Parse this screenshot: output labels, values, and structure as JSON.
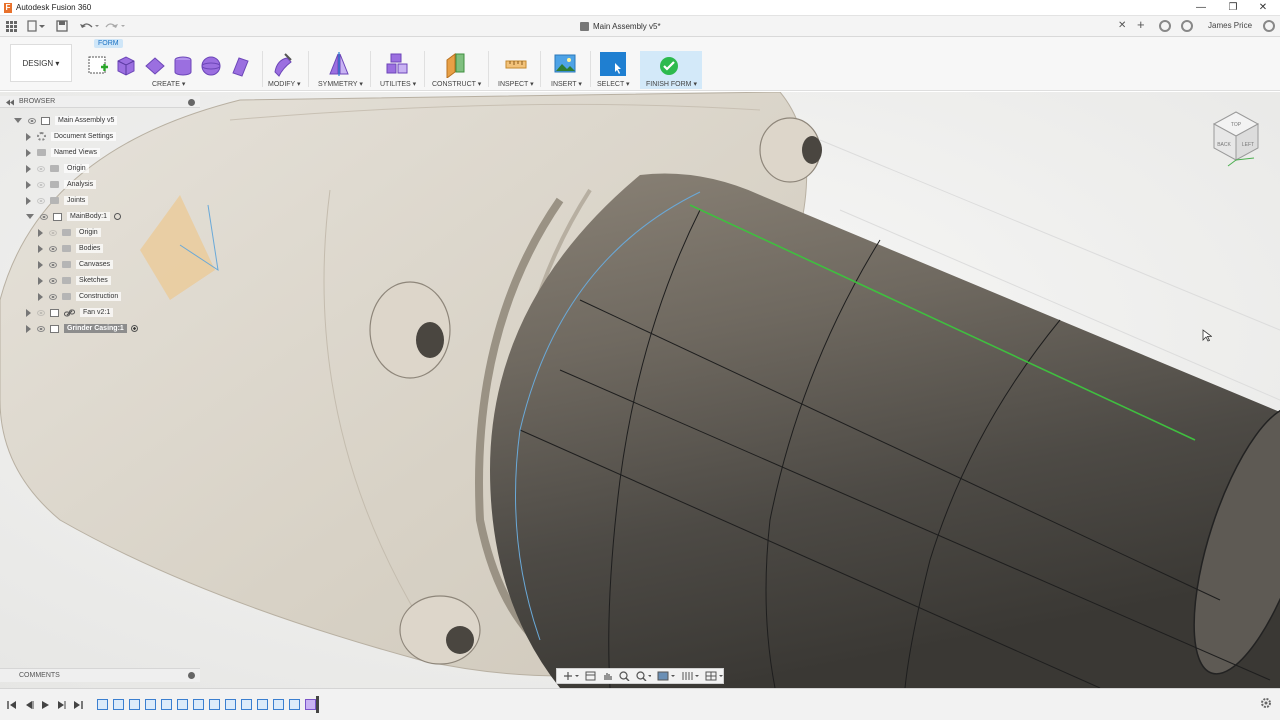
{
  "window": {
    "app_title": "Autodesk Fusion 360",
    "logo_letter": "F",
    "minimize": "—",
    "maximize": "❐",
    "close": "✕"
  },
  "tabbar": {
    "doc_title": "Main Assembly v5*",
    "close_tab": "✕",
    "new_tab": "+",
    "user": "James Price"
  },
  "toolbar": {
    "workspace": "DESIGN ▾",
    "active_tab": "FORM",
    "groups": {
      "create": "CREATE ▾",
      "modify": "MODIFY ▾",
      "symmetry": "SYMMETRY ▾",
      "utilities": "UTILITES ▾",
      "construct": "CONSTRUCT ▾",
      "inspect": "INSPECT ▾",
      "insert": "INSERT ▾",
      "select": "SELECT ▾",
      "finish": "FINISH FORM ▾"
    }
  },
  "browser": {
    "title": "BROWSER",
    "items": [
      {
        "label": "Main Assembly v5"
      },
      {
        "label": "Document Settings"
      },
      {
        "label": "Named Views"
      },
      {
        "label": "Origin"
      },
      {
        "label": "Analysis"
      },
      {
        "label": "Joints"
      },
      {
        "label": "MainBody:1"
      },
      {
        "label": "Origin"
      },
      {
        "label": "Bodies"
      },
      {
        "label": "Canvases"
      },
      {
        "label": "Sketches"
      },
      {
        "label": "Construction"
      },
      {
        "label": "Fan v2:1"
      },
      {
        "label": "Grinder Casing:1"
      }
    ]
  },
  "comments": {
    "title": "COMMENTS"
  },
  "viewcube": {
    "top": "TOP",
    "front": "BACK",
    "right": "LEFT"
  },
  "colors": {
    "accent": "#1f7fd1",
    "finish_bg": "#d3e9f9",
    "form_tab": "#cfe6f8",
    "selection_green": "#3fbf3f",
    "sketch_blue": "#6aa9d8",
    "body_dark": "#5b5650"
  }
}
